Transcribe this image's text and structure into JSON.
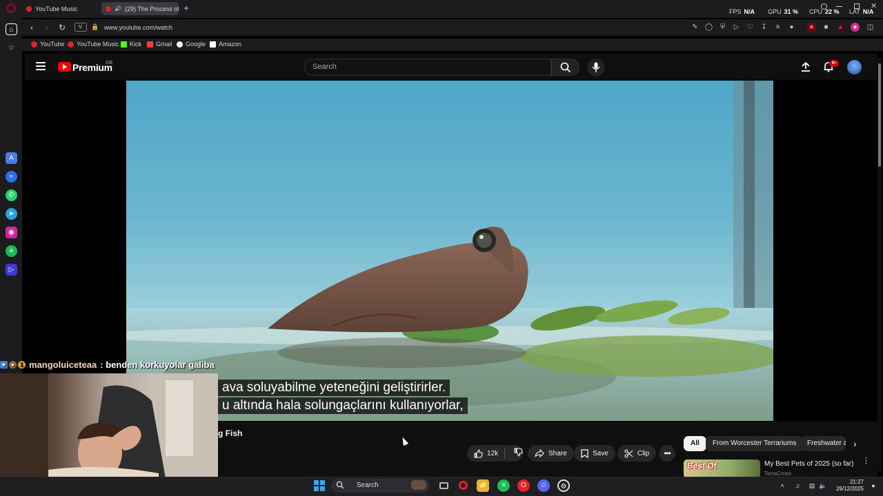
{
  "browser": {
    "tabs": [
      {
        "title": "YouTube Music"
      },
      {
        "title": "(29) The Process of M"
      }
    ],
    "perf": [
      {
        "label": "FPS",
        "value": "N/A"
      },
      {
        "label": "GPU",
        "value": "31 %"
      },
      {
        "label": "CPU",
        "value": "22 %"
      },
      {
        "label": "LAT",
        "value": "N/A"
      }
    ],
    "url": "www.youtube.com/watch",
    "vbadge": "V.",
    "bookmarks": [
      {
        "label": "YouTube",
        "color": "#e5202a"
      },
      {
        "label": "YouTube Music",
        "color": "#e5202a"
      },
      {
        "label": "Kick",
        "color": "#53fc18"
      },
      {
        "label": "Gmail",
        "color": "#ea4335"
      },
      {
        "label": "Google",
        "color": "#ffffff"
      },
      {
        "label": "Amazon",
        "color": "#ffffff"
      }
    ]
  },
  "youtube": {
    "brand": "Premium",
    "country": "GB",
    "search_placeholder": "Search",
    "notification_count": "9+",
    "subtitles": [
      "ava soluyabilme yeteneğini geliştirirler.",
      "u altında hala solungaçlarını kullanıyorlar,"
    ],
    "video_title": "g Fish",
    "actions": {
      "likes": "12k",
      "share": "Share",
      "save": "Save",
      "clip": "Clip"
    },
    "chips": [
      "All",
      "From Worcester Terrariums",
      "Freshwater a"
    ],
    "recommendation": {
      "thumb_text": "Best Of",
      "title": "My Best Pets of 2025 (so far)",
      "channel": "TerraCross"
    }
  },
  "stream": {
    "chat_user": "mangoluiceteaa",
    "chat_message": ": benden korkuyolar galiba",
    "sub_badge": "1"
  },
  "taskbar": {
    "search": "Search",
    "time": "21:27",
    "date": "29/12/2025"
  },
  "colors": {
    "accent": "#e5202a",
    "youtube_red": "#ff0000",
    "background": "#0f0f0f"
  }
}
